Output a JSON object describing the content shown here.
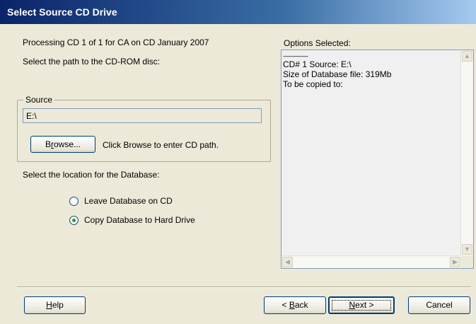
{
  "window": {
    "title": "Select Source CD Drive"
  },
  "intro": {
    "processing": "Processing CD 1 of 1 for CA on CD January 2007",
    "path_prompt": "Select the path to the CD-ROM disc:"
  },
  "source": {
    "group_label": "Source",
    "path_value": "E:\\",
    "browse_label_pre": "B",
    "browse_label_ul": "r",
    "browse_label_post": "owse...",
    "browse_hint": "Click Browse to enter CD path."
  },
  "database": {
    "prompt": "Select the location for the Database:",
    "options": [
      {
        "label": "Leave Database on CD",
        "selected": false
      },
      {
        "label": "Copy Database to Hard Drive",
        "selected": true
      }
    ]
  },
  "options_panel": {
    "label": "Options Selected:",
    "lines": [
      "---------------------",
      "CD# 1 Source: E:\\",
      "Size of Database file: 319Mb",
      "To be copied to:"
    ]
  },
  "buttons": {
    "help_ul": "H",
    "help_rest": "elp",
    "back_pre": "< ",
    "back_ul": "B",
    "back_rest": "ack",
    "next_ul": "N",
    "next_rest": "ext >",
    "cancel": "Cancel"
  },
  "icons": {
    "scroll_up": "up-arrow-icon",
    "scroll_down": "down-arrow-icon",
    "scroll_left": "left-arrow-icon",
    "scroll_right": "right-arrow-icon"
  }
}
